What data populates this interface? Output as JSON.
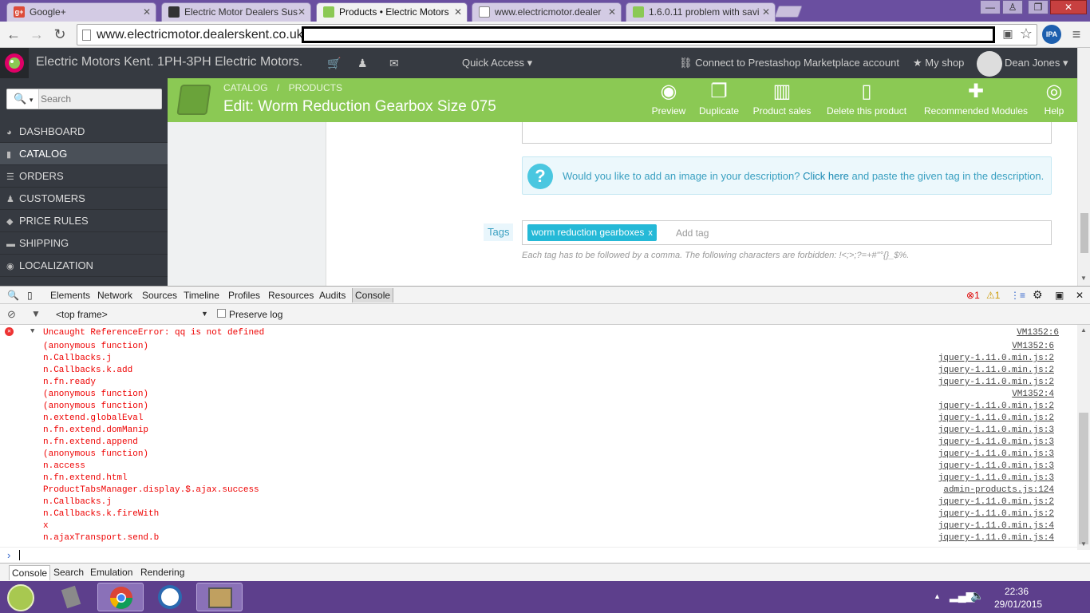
{
  "browser": {
    "tabs": [
      {
        "title": "Google+",
        "favicon_color": "#dd4b39"
      },
      {
        "title": "Electric Motor Dealers Sus",
        "favicon_color": "#333333"
      },
      {
        "title": "Products • Electric Motors",
        "favicon_color": "#8bc954",
        "active": true
      },
      {
        "title": "www.electricmotor.dealer",
        "favicon_color": "#ffffff"
      },
      {
        "title": "1.6.0.11 problem with savi",
        "favicon_color": "#8bc954"
      }
    ],
    "url": "www.electricmotor.dealerskent.co.uk/",
    "window_buttons": {
      "minimize": "—",
      "restore": "❐",
      "close": "✕"
    },
    "extension_label": "IPA"
  },
  "ps_header": {
    "shop_name": "Electric Motors Kent.  1PH-3PH Electric Motors.",
    "quick_access": "Quick Access ▾",
    "connect": "Connect to Prestashop Marketplace account",
    "my_shop": "My shop",
    "user": "Dean Jones ▾"
  },
  "sidebar": {
    "search_placeholder": "Search",
    "items": [
      {
        "label": "DASHBOARD",
        "icon": "◕"
      },
      {
        "label": "CATALOG",
        "icon": "▮",
        "active": true
      },
      {
        "label": "ORDERS",
        "icon": "☰"
      },
      {
        "label": "CUSTOMERS",
        "icon": "♟"
      },
      {
        "label": "PRICE RULES",
        "icon": "◆"
      },
      {
        "label": "SHIPPING",
        "icon": "▬"
      },
      {
        "label": "LOCALIZATION",
        "icon": "◉"
      }
    ]
  },
  "toolbar": {
    "breadcrumb_1": "CATALOG",
    "breadcrumb_sep": "/",
    "breadcrumb_2": "PRODUCTS",
    "title": "Edit: Worm Reduction Gearbox Size 075",
    "buttons": [
      {
        "label": "Preview",
        "icon": "👁"
      },
      {
        "label": "Duplicate",
        "icon": "❐"
      },
      {
        "label": "Product sales",
        "icon": "▥"
      },
      {
        "label": "Delete this product",
        "icon": "🗑"
      },
      {
        "label": "Recommended Modules",
        "icon": "✚"
      },
      {
        "label": "Help",
        "icon": "◎"
      }
    ]
  },
  "content": {
    "info_before": "Would you like to add an image in your description? ",
    "info_link": "Click here",
    "info_after": " and paste the given tag in the description.",
    "tags_label": "Tags",
    "tag_chip": "worm reduction gearboxes",
    "tag_chip_close": "x",
    "add_tag_placeholder": "Add tag",
    "tags_help": "Each tag has to be followed by a comma. The following characters are forbidden: !<;>;?=+#\"°{}_$%."
  },
  "devtools": {
    "tabs": [
      "Elements",
      "Network",
      "Sources",
      "Timeline",
      "Profiles",
      "Resources",
      "Audits",
      "Console"
    ],
    "active_tab": "Console",
    "error_count": "1",
    "warning_count": "1",
    "frame_select": "<top frame>",
    "preserve_log": "Preserve log",
    "error_title": "Uncaught ReferenceError: qq is not defined",
    "error_source": "VM1352:6",
    "stack": [
      {
        "fn": "(anonymous function)",
        "src": "VM1352:6"
      },
      {
        "fn": "n.Callbacks.j",
        "src": "jquery-1.11.0.min.js:2"
      },
      {
        "fn": "n.Callbacks.k.add",
        "src": "jquery-1.11.0.min.js:2"
      },
      {
        "fn": "n.fn.ready",
        "src": "jquery-1.11.0.min.js:2"
      },
      {
        "fn": "(anonymous function)",
        "src": "VM1352:4"
      },
      {
        "fn": "(anonymous function)",
        "src": "jquery-1.11.0.min.js:2"
      },
      {
        "fn": "n.extend.globalEval",
        "src": "jquery-1.11.0.min.js:2"
      },
      {
        "fn": "n.fn.extend.domManip",
        "src": "jquery-1.11.0.min.js:3"
      },
      {
        "fn": "n.fn.extend.append",
        "src": "jquery-1.11.0.min.js:3"
      },
      {
        "fn": "(anonymous function)",
        "src": "jquery-1.11.0.min.js:3"
      },
      {
        "fn": "n.access",
        "src": "jquery-1.11.0.min.js:3"
      },
      {
        "fn": "n.fn.extend.html",
        "src": "jquery-1.11.0.min.js:3"
      },
      {
        "fn": "ProductTabsManager.display.$.ajax.success",
        "src": "admin-products.js:124"
      },
      {
        "fn": "n.Callbacks.j",
        "src": "jquery-1.11.0.min.js:2"
      },
      {
        "fn": "n.Callbacks.k.fireWith",
        "src": "jquery-1.11.0.min.js:2"
      },
      {
        "fn": "x",
        "src": "jquery-1.11.0.min.js:4"
      },
      {
        "fn": "n.ajaxTransport.send.b",
        "src": "jquery-1.11.0.min.js:4"
      }
    ],
    "prompt": "›",
    "drawer_tabs": [
      "Console",
      "Search",
      "Emulation",
      "Rendering"
    ]
  },
  "taskbar": {
    "time": "22:36",
    "date": "29/01/2015",
    "tray_up": "▲",
    "volume": "🔊"
  },
  "colors": {
    "ps_green": "#8bc954",
    "ps_dark": "#363a41",
    "error_red": "#ee0000",
    "taskbar": "#5d3f8c"
  }
}
